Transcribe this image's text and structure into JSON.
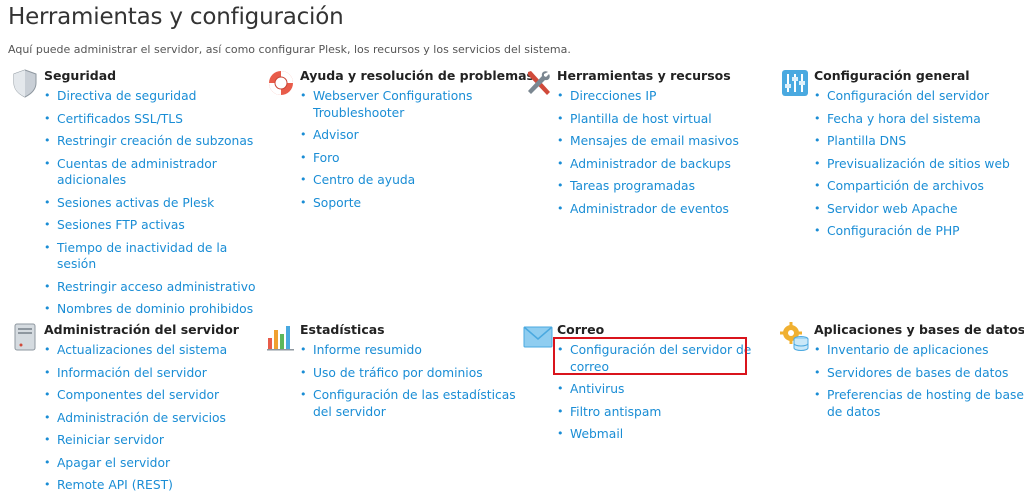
{
  "page": {
    "title": "Herramientas y configuración",
    "subtitle": "Aquí puede administrar el servidor, así como configurar Plesk, los recursos y los servicios del sistema."
  },
  "colors": {
    "link": "#1a8dd5",
    "highlight": "#d9141c"
  },
  "sections": [
    {
      "icon": "shield-icon",
      "title": "Seguridad",
      "links": [
        "Directiva de seguridad",
        "Certificados SSL/TLS",
        "Restringir creación de subzonas",
        "Cuentas de administrador adicionales",
        "Sesiones activas de Plesk",
        "Sesiones FTP activas",
        "Tiempo de inactividad de la sesión",
        "Restringir acceso administrativo",
        "Nombres de dominio prohibidos"
      ]
    },
    {
      "icon": "lifebuoy-icon",
      "title": "Ayuda y resolución de problemas",
      "links": [
        "Webserver Configurations Troubleshooter",
        "Advisor",
        "Foro",
        "Centro de ayuda",
        "Soporte"
      ]
    },
    {
      "icon": "tools-icon",
      "title": "Herramientas y recursos",
      "links": [
        "Direcciones IP",
        "Plantilla de host virtual",
        "Mensajes de email masivos",
        "Administrador de backups",
        "Tareas programadas",
        "Administrador de eventos"
      ]
    },
    {
      "icon": "sliders-icon",
      "title": "Configuración general",
      "links": [
        "Configuración del servidor",
        "Fecha y hora del sistema",
        "Plantilla DNS",
        "Previsualización de sitios web",
        "Compartición de archivos",
        "Servidor web Apache",
        "Configuración de PHP"
      ]
    },
    {
      "icon": "server-icon",
      "title": "Administración del servidor",
      "links": [
        "Actualizaciones del sistema",
        "Información del servidor",
        "Componentes del servidor",
        "Administración de servicios",
        "Reiniciar servidor",
        "Apagar el servidor",
        "Remote API (REST)"
      ]
    },
    {
      "icon": "bar-chart-icon",
      "title": "Estadísticas",
      "links": [
        "Informe resumido",
        "Uso de tráfico por dominios",
        "Configuración de las estadísticas del servidor"
      ]
    },
    {
      "icon": "envelope-icon",
      "title": "Correo",
      "links": [
        "Configuración del servidor de correo",
        "Antivirus",
        "Filtro antispam",
        "Webmail"
      ]
    },
    {
      "icon": "gear-database-icon",
      "title": "Aplicaciones y bases de datos",
      "links": [
        "Inventario de aplicaciones",
        "Servidores de bases de datos",
        "Preferencias de hosting de bases de datos"
      ]
    }
  ]
}
